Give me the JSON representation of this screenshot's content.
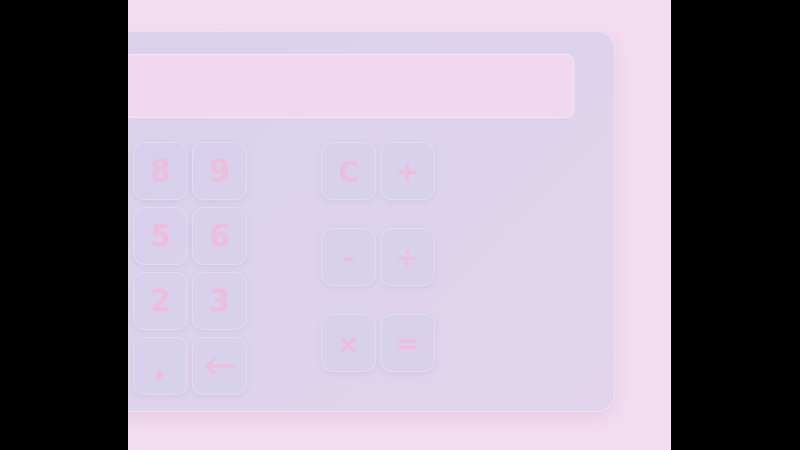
{
  "display": {
    "value": ""
  },
  "keys": {
    "k8": "8",
    "k9": "9",
    "k5": "5",
    "k6": "6",
    "k2": "2",
    "k3": "3",
    "comma": ",",
    "clear": "C",
    "plus": "+",
    "minus": "-",
    "divide": "÷",
    "multiply": "×",
    "equals": "="
  },
  "icons": {
    "backspace": "left-arrow-icon"
  },
  "colors": {
    "page_bg": "#f4ddf0",
    "calc_body": "#dcd3eb",
    "key_bg": "#d6d0ec",
    "key_text": "#eebcdc",
    "display_bg": "#f1d8f0"
  }
}
